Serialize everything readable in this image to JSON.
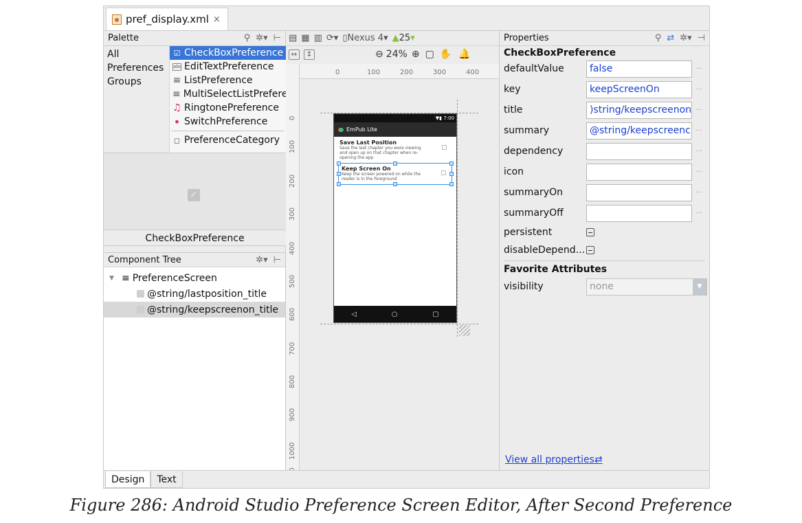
{
  "file_tab": {
    "name": "pref_display.xml",
    "close": "×"
  },
  "palette": {
    "title": "Palette",
    "groups": [
      "All",
      "Preferences",
      "Groups"
    ],
    "items": [
      {
        "label": "CheckBoxPreference",
        "icon": "☑"
      },
      {
        "label": "EditTextPreference",
        "icon": "abc"
      },
      {
        "label": "ListPreference",
        "icon": "≡"
      },
      {
        "label": "MultiSelectListPrefere",
        "icon": "≡"
      },
      {
        "label": "RingtonePreference",
        "icon": "♫"
      },
      {
        "label": "SwitchPreference",
        "icon": "•"
      }
    ],
    "category_item": {
      "label": "PreferenceCategory",
      "icon": "◻"
    },
    "preview_label": "CheckBoxPreference"
  },
  "component_tree": {
    "title": "Component Tree",
    "root": "PreferenceScreen",
    "children": [
      "@string/lastposition_title",
      "@string/keepscreenon_title"
    ]
  },
  "toolbar": {
    "device": "Nexus 4",
    "api": "25",
    "zoom": "24%"
  },
  "ruler": {
    "h": [
      "0",
      "100",
      "200",
      "300",
      "400"
    ],
    "v": [
      "0",
      "100",
      "200",
      "300",
      "400",
      "500",
      "600",
      "700",
      "800",
      "900",
      "1000",
      "00"
    ]
  },
  "device_preview": {
    "time": "7:00",
    "app_title": "EmPub Lite",
    "prefs": [
      {
        "title": "Save Last Position",
        "summary": "Save the last chapter you were viewing and open up on that chapter when re-opening the app"
      },
      {
        "title": "Keep Screen On",
        "summary": "Keep the screen powered on while the reader is in the foreground"
      }
    ]
  },
  "properties": {
    "title": "Properties",
    "component": "CheckBoxPreference",
    "rows": [
      {
        "name": "defaultValue",
        "value": "false"
      },
      {
        "name": "key",
        "value": "keepScreenOn"
      },
      {
        "name": "title",
        "value": ")string/keepscreenon"
      },
      {
        "name": "summary",
        "value": "@string/keepscreenc"
      },
      {
        "name": "dependency",
        "value": ""
      },
      {
        "name": "icon",
        "value": ""
      },
      {
        "name": "summaryOn",
        "value": ""
      },
      {
        "name": "summaryOff",
        "value": ""
      }
    ],
    "persistent_label": "persistent",
    "disable_label": "disableDepend...",
    "favorites_title": "Favorite Attributes",
    "visibility_label": "visibility",
    "visibility_value": "none",
    "view_all": "View all properties"
  },
  "bottom_tabs": [
    "Design",
    "Text"
  ],
  "caption": "Figure 286: Android Studio Preference Screen Editor, After Second Preference"
}
